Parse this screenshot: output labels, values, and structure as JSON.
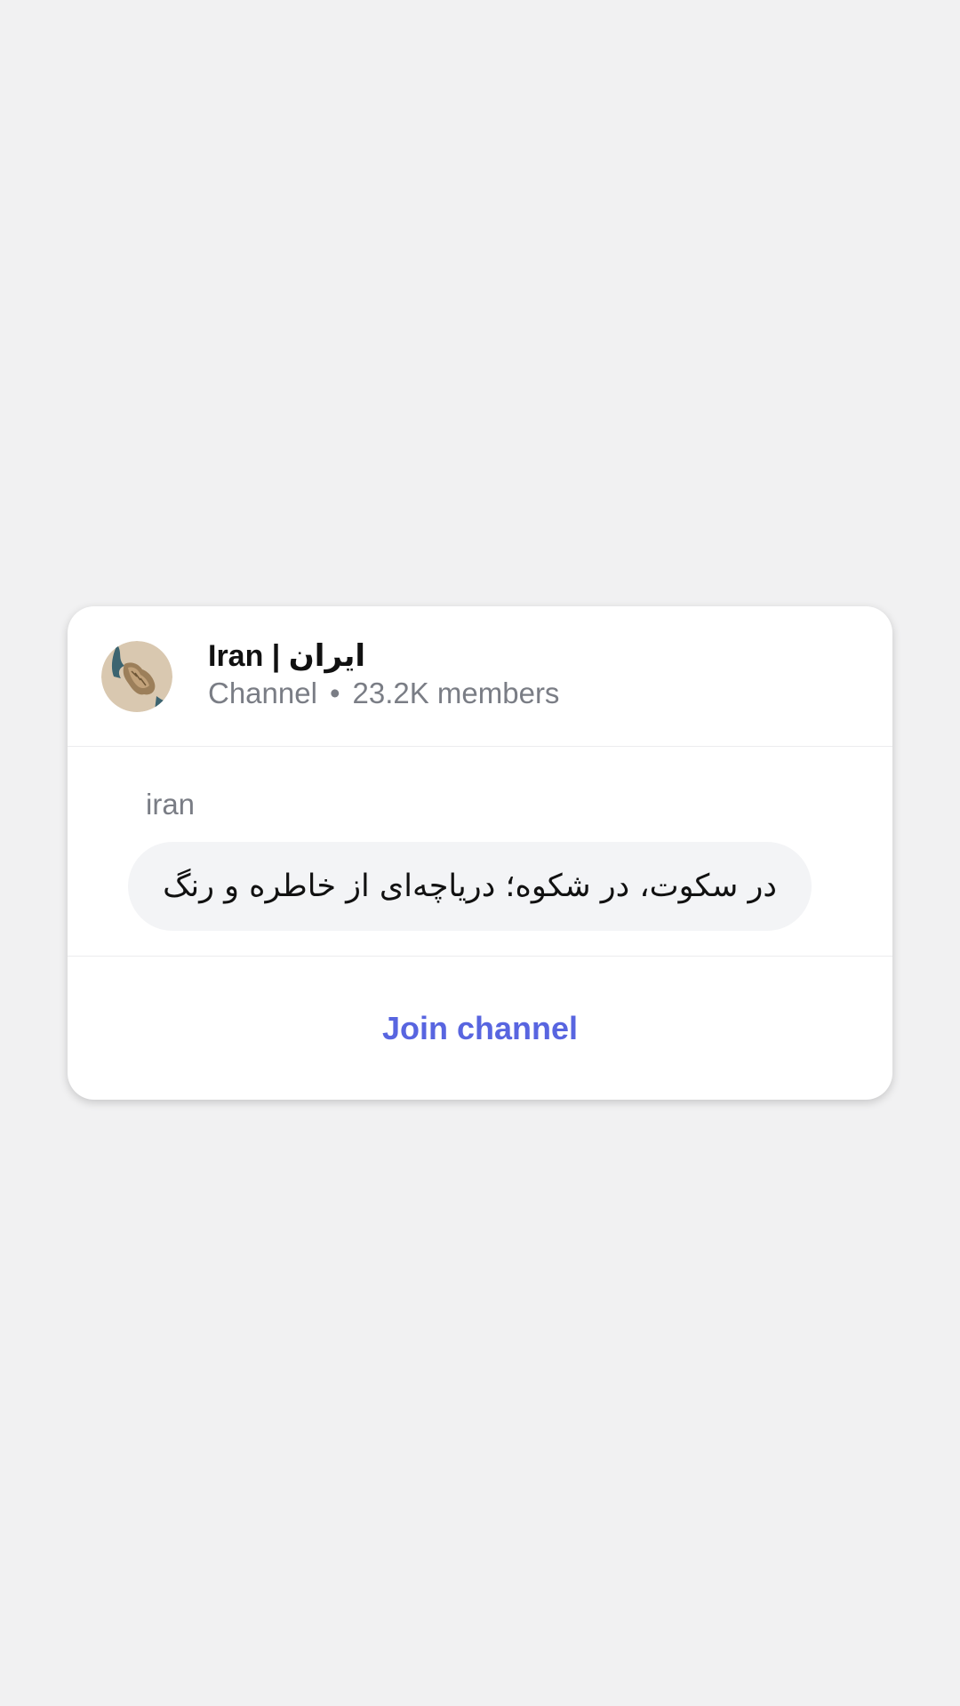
{
  "channel": {
    "name": "Iran | ایران",
    "type": "Channel",
    "separator": "•",
    "members": "23.2K members",
    "avatar_icon": "iran-map-avatar-icon"
  },
  "post": {
    "handle": "iran",
    "message": "در سکوت، در شکوه؛ دریاچه‌ای از خاطره و رنگ"
  },
  "actions": {
    "join_label": "Join channel"
  },
  "colors": {
    "accent": "#5865e0",
    "background": "#f1f1f2",
    "card": "#ffffff",
    "bubble": "#f3f4f6",
    "muted_text": "#7a7d85"
  }
}
